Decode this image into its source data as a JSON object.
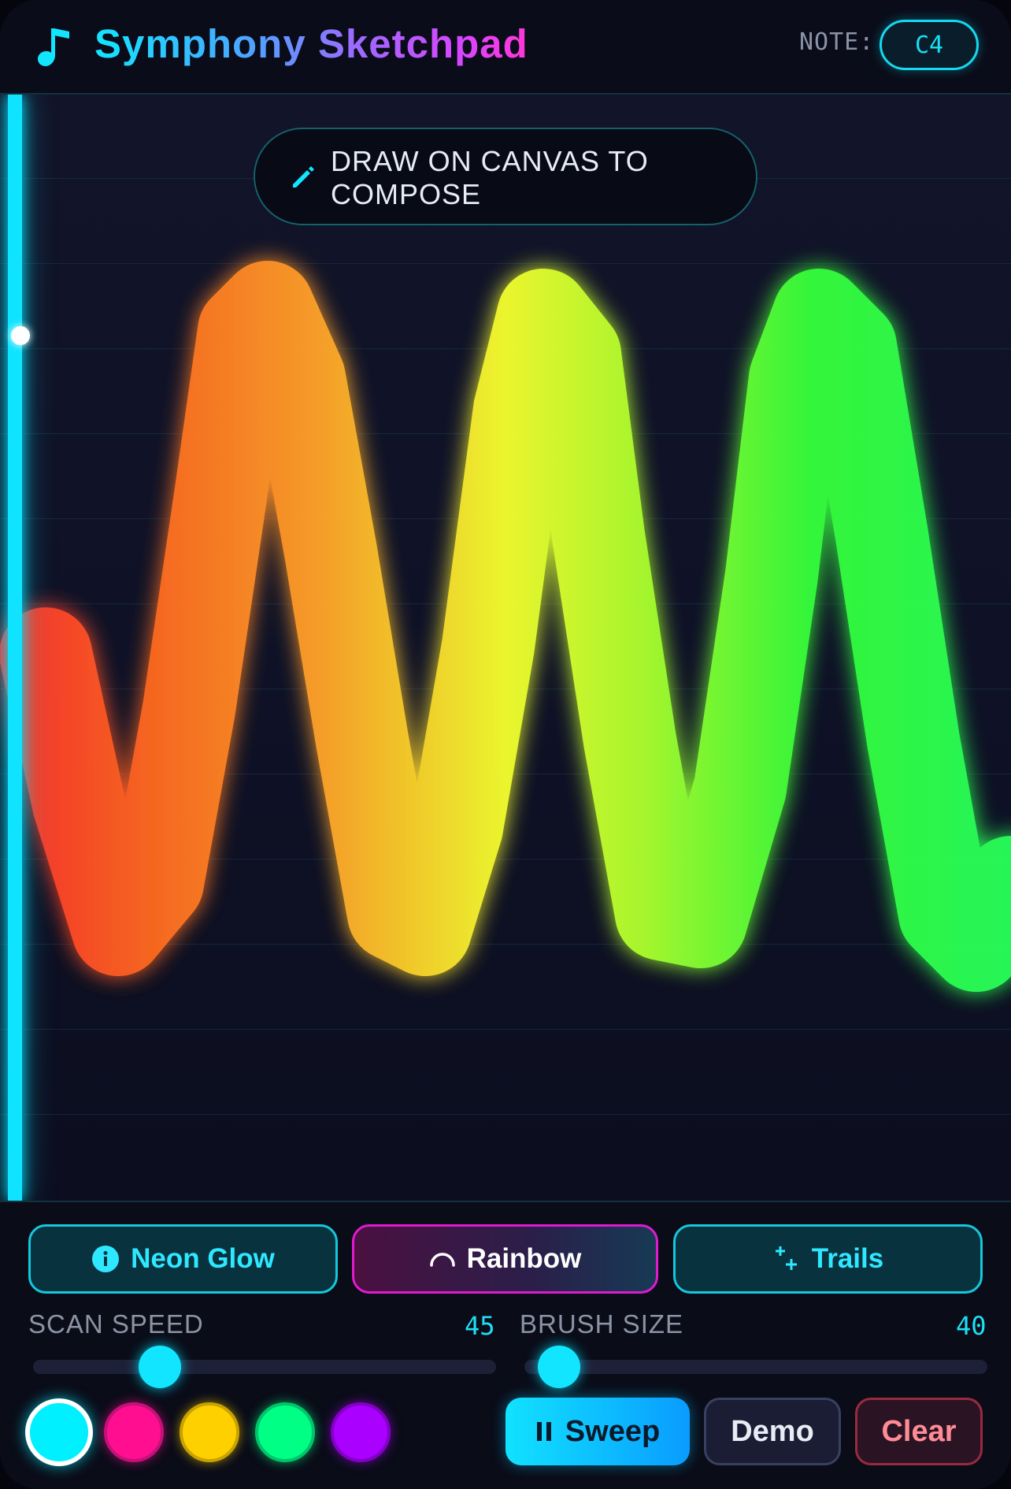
{
  "header": {
    "title": "Symphony Sketchpad",
    "note_label": "NOTE:",
    "note_value": "C4"
  },
  "canvas": {
    "hint": "DRAW ON CANVAS TO COMPOSE",
    "stroke_colors": [
      "#ff2f2f",
      "#ff6a1f",
      "#ffa42a",
      "#f4ff2e",
      "#aaff2e",
      "#36ff3a",
      "#28ff5a"
    ]
  },
  "modes": {
    "neon_glow": "Neon Glow",
    "rainbow": "Rainbow",
    "trails": "Trails"
  },
  "sliders": {
    "scan_speed": {
      "label": "SCAN SPEED",
      "value": "45"
    },
    "brush_size": {
      "label": "BRUSH SIZE",
      "value": "40"
    }
  },
  "palette": {
    "colors": [
      "#00f0ff",
      "#ff0f8f",
      "#ffd000",
      "#00ff85",
      "#aa00ff"
    ],
    "selected": "#00f0ff"
  },
  "actions": {
    "sweep": "Sweep",
    "demo": "Demo",
    "clear": "Clear"
  },
  "theme": {
    "accent": "#12e5ff",
    "magenta": "#e01ad0",
    "background": "#0b0d1a"
  }
}
